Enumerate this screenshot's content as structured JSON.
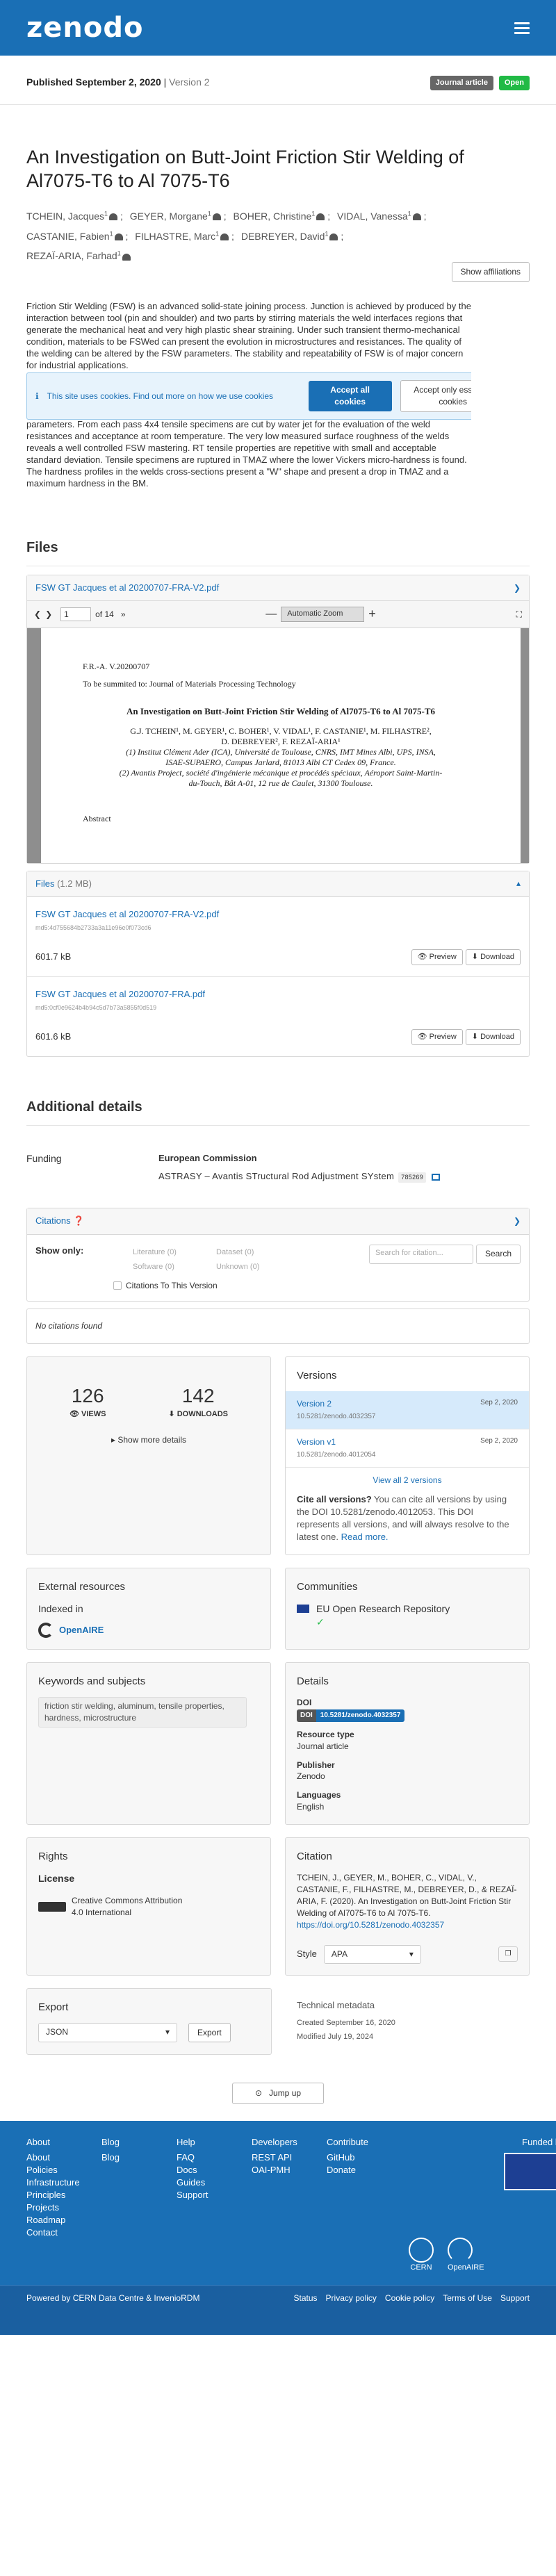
{
  "header": {
    "logo": "zenodo"
  },
  "published": {
    "label": "Published September 2, 2020",
    "version": "Version 2",
    "badge_type": "Journal article",
    "badge_open": "Open"
  },
  "title": "An Investigation on Butt-Joint Friction Stir Welding of Al7075-T6 to Al 7075-T6",
  "authors": [
    {
      "name": "TCHEIN, Jacques",
      "sup": "1"
    },
    {
      "name": "GEYER, Morgane",
      "sup": "1"
    },
    {
      "name": "BOHER, Christine",
      "sup": "1"
    },
    {
      "name": "VIDAL, Vanessa",
      "sup": "1"
    },
    {
      "name": "CASTANIE, Fabien",
      "sup": "1"
    },
    {
      "name": "FILHASTRE, Marc",
      "sup": "1"
    },
    {
      "name": "DEBREYER, David",
      "sup": "1"
    },
    {
      "name": "REZAÏ-ARIA, Farhad",
      "sup": "1"
    }
  ],
  "show_affiliations": "Show affiliations",
  "abstract_top": "Friction Stir Welding (FSW) is an advanced solid-state joining process. Junction is achieved by produced by the interaction between tool (pin and shoulder) and two parts by stirring materials the weld interfaces regions that generate the mechanical heat and very high plastic shear straining. Under such transient thermo-mechanical condition, materials to be FSWed can present the evolution in microstructures and resistances. The quality of the welding can be altered by the FSW parameters. The stability and repeatability of FSW is of major concern for industrial applications.",
  "abstract_bottom": "parameters. From each pass 4x4 tensile specimens are cut by water jet for the evaluation of the weld resistances and acceptance at room temperature. The very low measured surface roughness of the welds reveals a well controlled FSW mastering. RT tensile properties are repetitive with small and acceptable standard deviation. Tensile specimens are ruptured in TMAZ where the lower Vickers micro-hardness is found. The hardness profiles in the welds cross-sections present a \"W\" shape and present a drop in TMAZ and a maximum hardness in the BM.",
  "cookie": {
    "text": "This site uses cookies. Find out more on how we use cookies",
    "accept_all": "Accept all cookies",
    "accept_essential": "Accept only essential cookies",
    "close": "×"
  },
  "files": {
    "heading": "Files",
    "preview_file": "FSW GT Jacques et al 20200707-FRA-V2.pdf",
    "pdf_page": "1",
    "pdf_of": "of 14",
    "zoom": "Automatic Zoom",
    "pdf_lines": {
      "ref": "F.R.-A. V.20200707",
      "submitted": "To be summited to: Journal of Materials Processing Technology",
      "title": "An Investigation on Butt-Joint Friction Stir Welding of Al7075-T6 to Al 7075-T6",
      "authors1": "G.J. TCHEIN¹, M. GEYER¹, C. BOHER¹, V. VIDAL¹, F. CASTANIE¹, M. FILHASTRE²,",
      "authors2": "D. DEBREYER², F. REZAÏ-ARIA¹",
      "aff1": "(1) Institut Clément Ader (ICA), Université de Toulouse, CNRS, IMT Mines Albi, UPS, INSA,",
      "aff2": "ISAE-SUPAERO, Campus Jarlard, 81013 Albi CT Cedex 09, France.",
      "aff3": "(2) Avantis Project, société d'ingénierie mécanique et procédés spéciaux, Aéroport Saint-Martin-",
      "aff4": "du-Touch, Bât A-01, 12 rue de Caulet, 31300 Toulouse.",
      "abstract": "Abstract"
    },
    "list_header": "Files",
    "list_size": "(1.2 MB)",
    "items": [
      {
        "name": "FSW GT Jacques et al 20200707-FRA-V2.pdf",
        "md5": "md5:4d755684b2733a3a11e96e0f073cd6",
        "size": "601.7 kB"
      },
      {
        "name": "FSW GT Jacques et al 20200707-FRA.pdf",
        "md5": "md5:0cf0e9624b4b94c5d7b73a5855f0d519",
        "size": "601.6 kB"
      }
    ],
    "preview": "Preview",
    "download": "Download"
  },
  "additional": {
    "heading": "Additional details",
    "funding_label": "Funding",
    "funder": "European Commission",
    "project": "ASTRASY – Avantis STructural Rod Adjustment SYstem",
    "grant": "785269"
  },
  "citations": {
    "header": "Citations",
    "show_only": "Show only:",
    "literature": "Literature (0)",
    "dataset": "Dataset (0)",
    "software": "Software (0)",
    "unknown": "Unknown (0)",
    "to_version": "Citations To This Version",
    "search_placeholder": "Search for citation...",
    "search_btn": "Search",
    "none": "No citations found"
  },
  "stats": {
    "views": "126",
    "views_label": "VIEWS",
    "downloads": "142",
    "downloads_label": "DOWNLOADS",
    "more": "Show more details"
  },
  "versions": {
    "heading": "Versions",
    "items": [
      {
        "name": "Version 2",
        "doi": "10.5281/zenodo.4032357",
        "date": "Sep 2, 2020",
        "active": true
      },
      {
        "name": "Version v1",
        "doi": "10.5281/zenodo.4012054",
        "date": "Sep 2, 2020",
        "active": false
      }
    ],
    "view_all": "View all 2 versions",
    "cite_all_bold": "Cite all versions?",
    "cite_all_text": "You can cite all versions by using the DOI 10.5281/zenodo.4012053. This DOI represents all versions, and will always resolve to the latest one.",
    "read_more": "Read more."
  },
  "external": {
    "heading": "External resources",
    "indexed": "Indexed in",
    "openaire": "OpenAIRE"
  },
  "communities": {
    "heading": "Communities",
    "name": "EU Open Research Repository"
  },
  "keywords": {
    "heading": "Keywords and subjects",
    "text": "friction stir welding, aluminum, tensile properties, hardness, microstructure"
  },
  "details": {
    "heading": "Details",
    "doi_label": "DOI",
    "doi_prefix": "DOI",
    "doi": "10.5281/zenodo.4032357",
    "rtype_label": "Resource type",
    "rtype": "Journal article",
    "publisher_label": "Publisher",
    "publisher": "Zenodo",
    "lang_label": "Languages",
    "lang": "English"
  },
  "rights": {
    "heading": "Rights",
    "license_label": "License",
    "license": "Creative Commons Attribution 4.0 International"
  },
  "citation": {
    "heading": "Citation",
    "text": "TCHEIN, J., GEYER, M., BOHER, C., VIDAL, V., CASTANIE, F., FILHASTRE, M., DEBREYER, D., & REZAÏ-ARIA, F. (2020). An Investigation on Butt-Joint Friction Stir Welding of Al7075-T6 to Al 7075-T6.",
    "link": "https://doi.org/10.5281/zenodo.4032357",
    "style_label": "Style",
    "style": "APA"
  },
  "export": {
    "heading": "Export",
    "format": "JSON",
    "btn": "Export"
  },
  "tech": {
    "heading": "Technical metadata",
    "created": "Created September 16, 2020",
    "modified": "Modified July 19, 2024"
  },
  "jump": "Jump up",
  "footer": {
    "cols": [
      {
        "head": "About",
        "items": [
          "About",
          "Policies",
          "Infrastructure",
          "Principles",
          "Projects",
          "Roadmap",
          "Contact"
        ]
      },
      {
        "head": "Blog",
        "items": [
          "Blog"
        ]
      },
      {
        "head": "Help",
        "items": [
          "FAQ",
          "Docs",
          "Guides",
          "Support"
        ]
      },
      {
        "head": "Developers",
        "items": [
          "REST API",
          "OAI-PMH"
        ]
      },
      {
        "head": "Contribute",
        "items": [
          "GitHub",
          "Donate"
        ]
      }
    ],
    "funded": "Funded by",
    "cern": "CERN",
    "openaire": "OpenAIRE",
    "powered": "Powered by CERN Data Centre & InvenioRDM",
    "links": [
      "Status",
      "Privacy policy",
      "Cookie policy",
      "Terms of Use",
      "Support"
    ]
  }
}
